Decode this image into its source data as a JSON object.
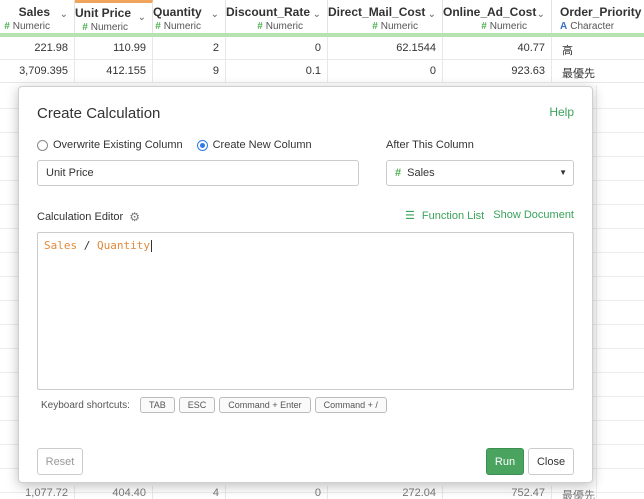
{
  "grid": {
    "columns": [
      {
        "name": "Sales",
        "type": "Numeric",
        "type_icon": "hash"
      },
      {
        "name": "Unit Price",
        "type": "Numeric",
        "type_icon": "hash"
      },
      {
        "name": "Quantity",
        "type": "Numeric",
        "type_icon": "hash"
      },
      {
        "name": "Discount_Rate",
        "type": "Numeric",
        "type_icon": "hash"
      },
      {
        "name": "Direct_Mail_Cost",
        "type": "Numeric",
        "type_icon": "hash"
      },
      {
        "name": "Online_Ad_Cost",
        "type": "Numeric",
        "type_icon": "hash"
      },
      {
        "name": "Order_Priority",
        "type": "Character",
        "type_icon": "alpha"
      }
    ],
    "rows": [
      [
        "221.98",
        "110.99",
        "2",
        "0",
        "62.1544",
        "40.77",
        "高"
      ],
      [
        "3,709.395",
        "412.155",
        "9",
        "0.1",
        "0",
        "923.63",
        "最優先"
      ]
    ],
    "partial_row": [
      "1,077.72",
      "404.40",
      "4",
      "0",
      "272.04",
      "752.47",
      "最優先"
    ],
    "colors": {
      "accent_header": "#b7e3b3",
      "active_column": "#f0a35b"
    }
  },
  "dialog": {
    "title": "Create Calculation",
    "help": "Help",
    "radio_overwrite": "Overwrite Existing Column",
    "radio_create": "Create New Column",
    "selected_mode": "create",
    "new_column_name": "Unit Price",
    "after_column_label": "After This Column",
    "after_column_value": "Sales",
    "editor_label": "Calculation Editor",
    "function_list": "Function List",
    "show_document": "Show Document",
    "expression": {
      "left": "Sales",
      "operator": "/",
      "right": "Quantity"
    },
    "shortcuts_label": "Keyboard shortcuts:",
    "shortcuts": [
      "TAB",
      "ESC",
      "Command + Enter",
      "Command + /"
    ],
    "reset": "Reset",
    "run": "Run",
    "close": "Close",
    "colors": {
      "link": "#3aa35c",
      "run_button": "#4aa35f",
      "code_token": "#e08a3b",
      "radio_selected": "#2d7be5"
    }
  }
}
